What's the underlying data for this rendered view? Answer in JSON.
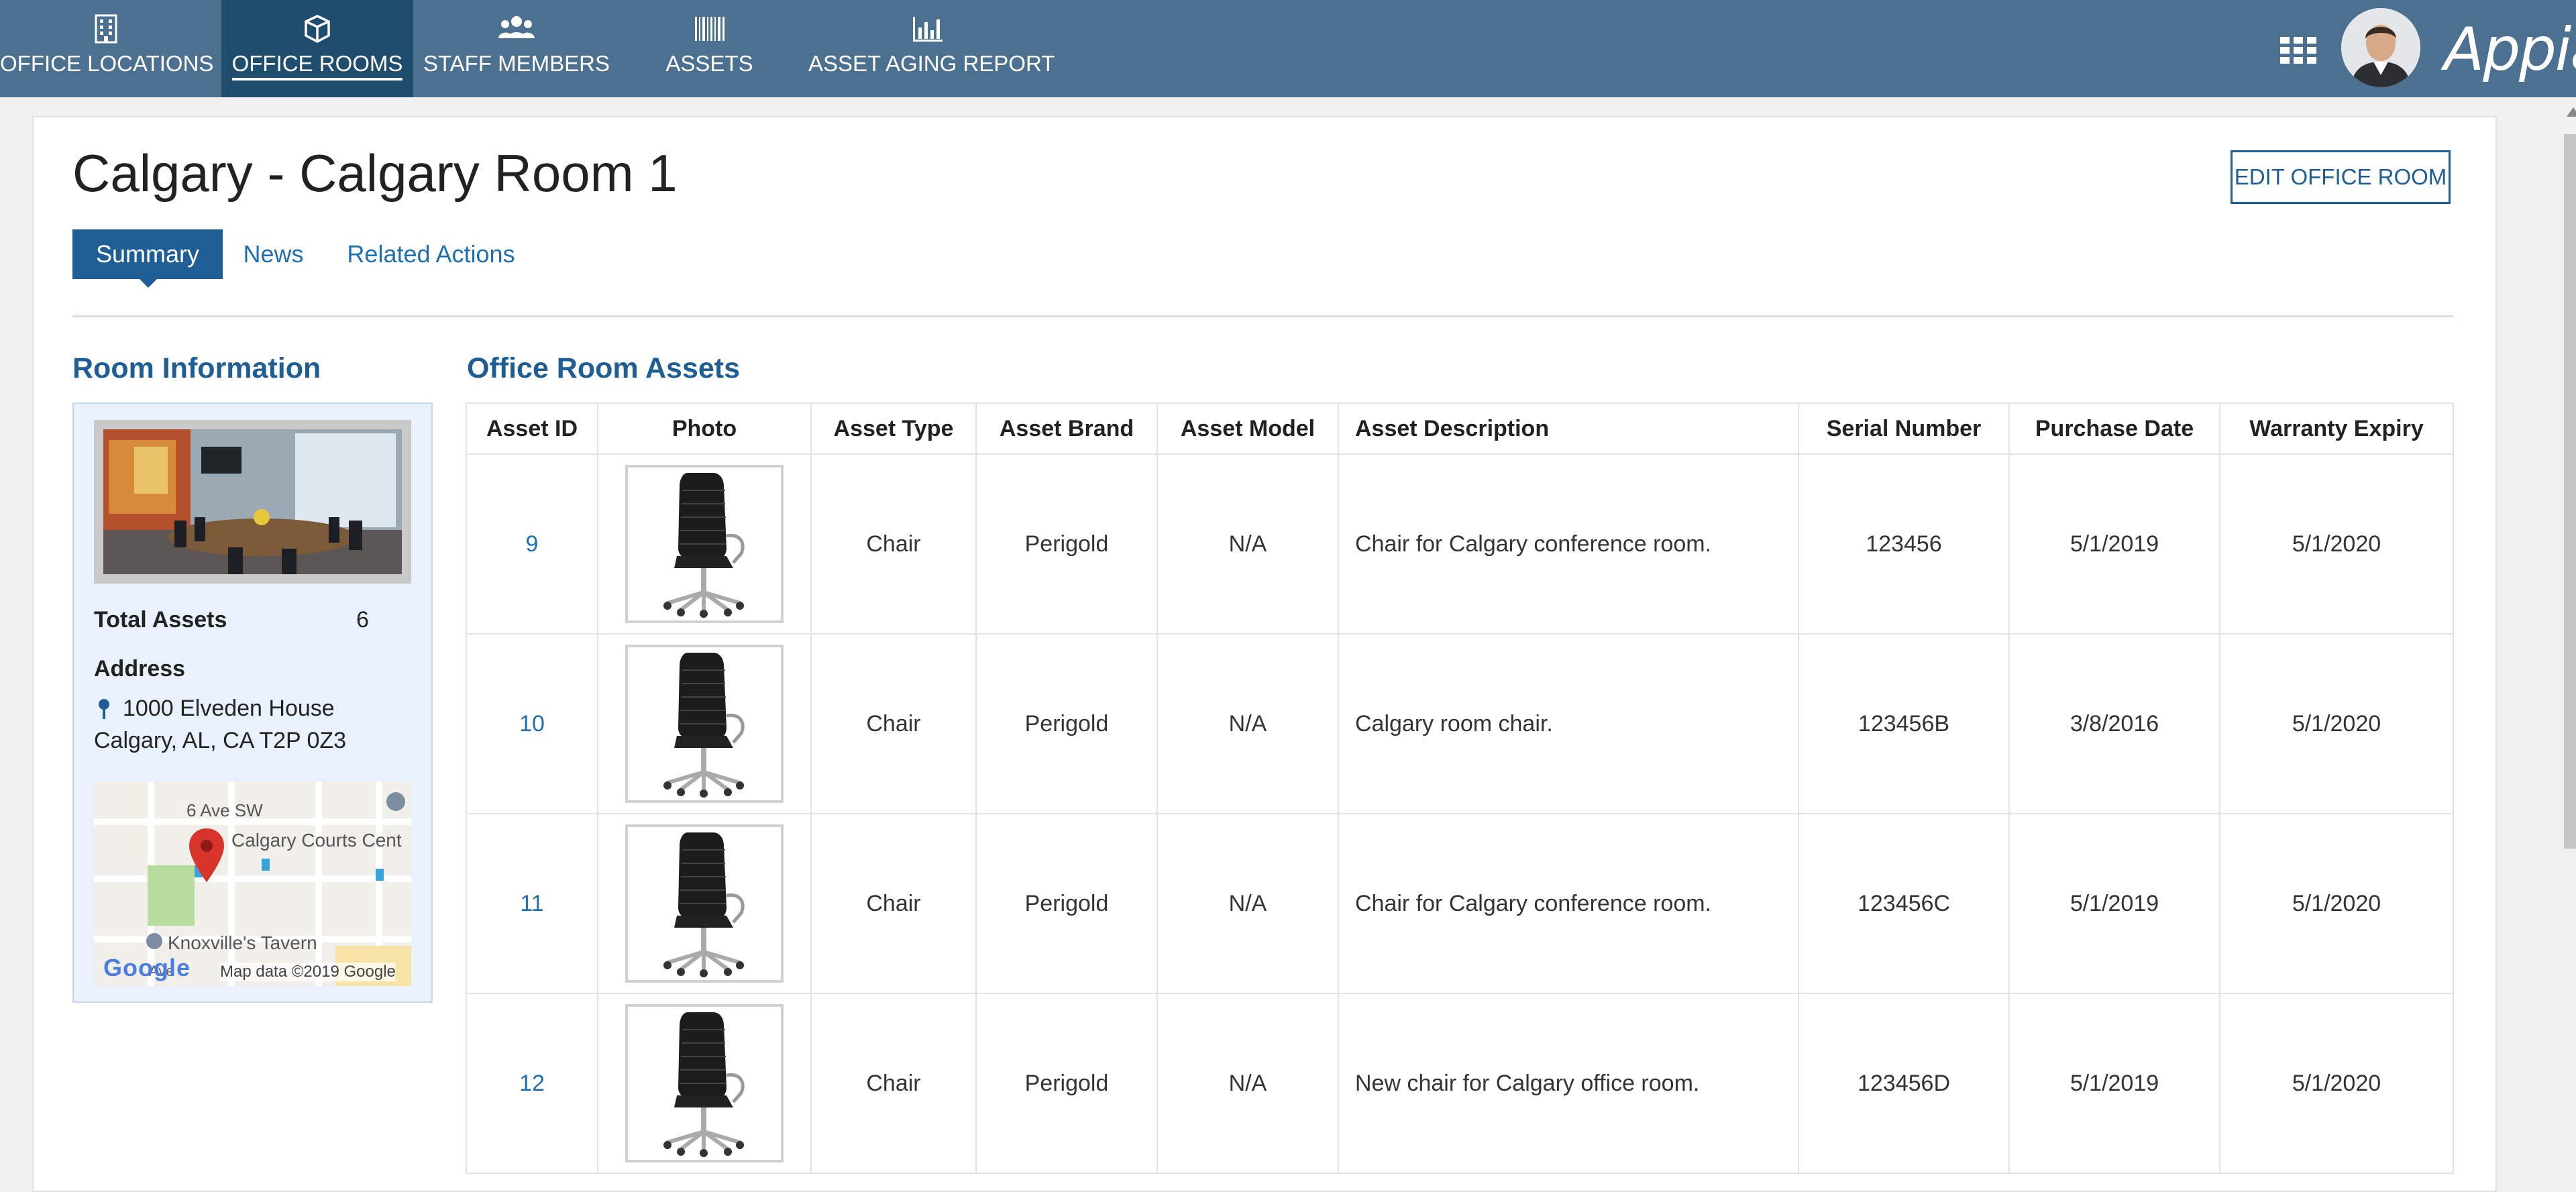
{
  "nav": {
    "tabs": [
      {
        "label": "OFFICE LOCATIONS",
        "icon": "building-icon"
      },
      {
        "label": "OFFICE ROOMS",
        "icon": "cube-icon",
        "active": true
      },
      {
        "label": "STAFF MEMBERS",
        "icon": "users-icon"
      },
      {
        "label": "ASSETS",
        "icon": "barcode-icon"
      },
      {
        "label": "ASSET AGING REPORT",
        "icon": "bar-chart-icon"
      }
    ],
    "brand": "Appian"
  },
  "page": {
    "title": "Calgary - Calgary Room 1",
    "edit_button": "EDIT OFFICE ROOM",
    "tabs": [
      "Summary",
      "News",
      "Related Actions"
    ]
  },
  "room_info": {
    "heading": "Room Information",
    "total_assets_label": "Total Assets",
    "total_assets_value": "6",
    "address_label": "Address",
    "address_line1": "1000 Elveden House",
    "address_line2": "Calgary, AL, CA T2P 0Z3",
    "map": {
      "street_label": "6 Ave SW",
      "place_label": "Calgary Courts Cent",
      "place2_label": "Knoxville's Tavern",
      "avenue_label": "Ave",
      "google_label": "Google",
      "copyright": "Map data ©2019 Google"
    }
  },
  "assets": {
    "heading": "Office Room Assets",
    "columns": [
      "Asset ID",
      "Photo",
      "Asset Type",
      "Asset Brand",
      "Asset Model",
      "Asset Description",
      "Serial Number",
      "Purchase Date",
      "Warranty Expiry"
    ],
    "rows": [
      {
        "id": "9",
        "type": "Chair",
        "brand": "Perigold",
        "model": "N/A",
        "description": "Chair for Calgary conference room.",
        "serial": "123456",
        "purchase": "5/1/2019",
        "warranty": "5/1/2020"
      },
      {
        "id": "10",
        "type": "Chair",
        "brand": "Perigold",
        "model": "N/A",
        "description": "Calgary room chair.",
        "serial": "123456B",
        "purchase": "3/8/2016",
        "warranty": "5/1/2020"
      },
      {
        "id": "11",
        "type": "Chair",
        "brand": "Perigold",
        "model": "N/A",
        "description": "Chair for Calgary conference room.",
        "serial": "123456C",
        "purchase": "5/1/2019",
        "warranty": "5/1/2020"
      },
      {
        "id": "12",
        "type": "Chair",
        "brand": "Perigold",
        "model": "N/A",
        "description": "New chair for Calgary office room.",
        "serial": "123456D",
        "purchase": "5/1/2019",
        "warranty": "5/1/2020"
      }
    ]
  },
  "colors": {
    "topbar": "#4b7090",
    "active_tab": "#1f4d6e",
    "accent": "#1e5e95",
    "link": "#1e6eb0",
    "panel_bg": "#e9f1fc",
    "map_pin": "#d9342b"
  }
}
